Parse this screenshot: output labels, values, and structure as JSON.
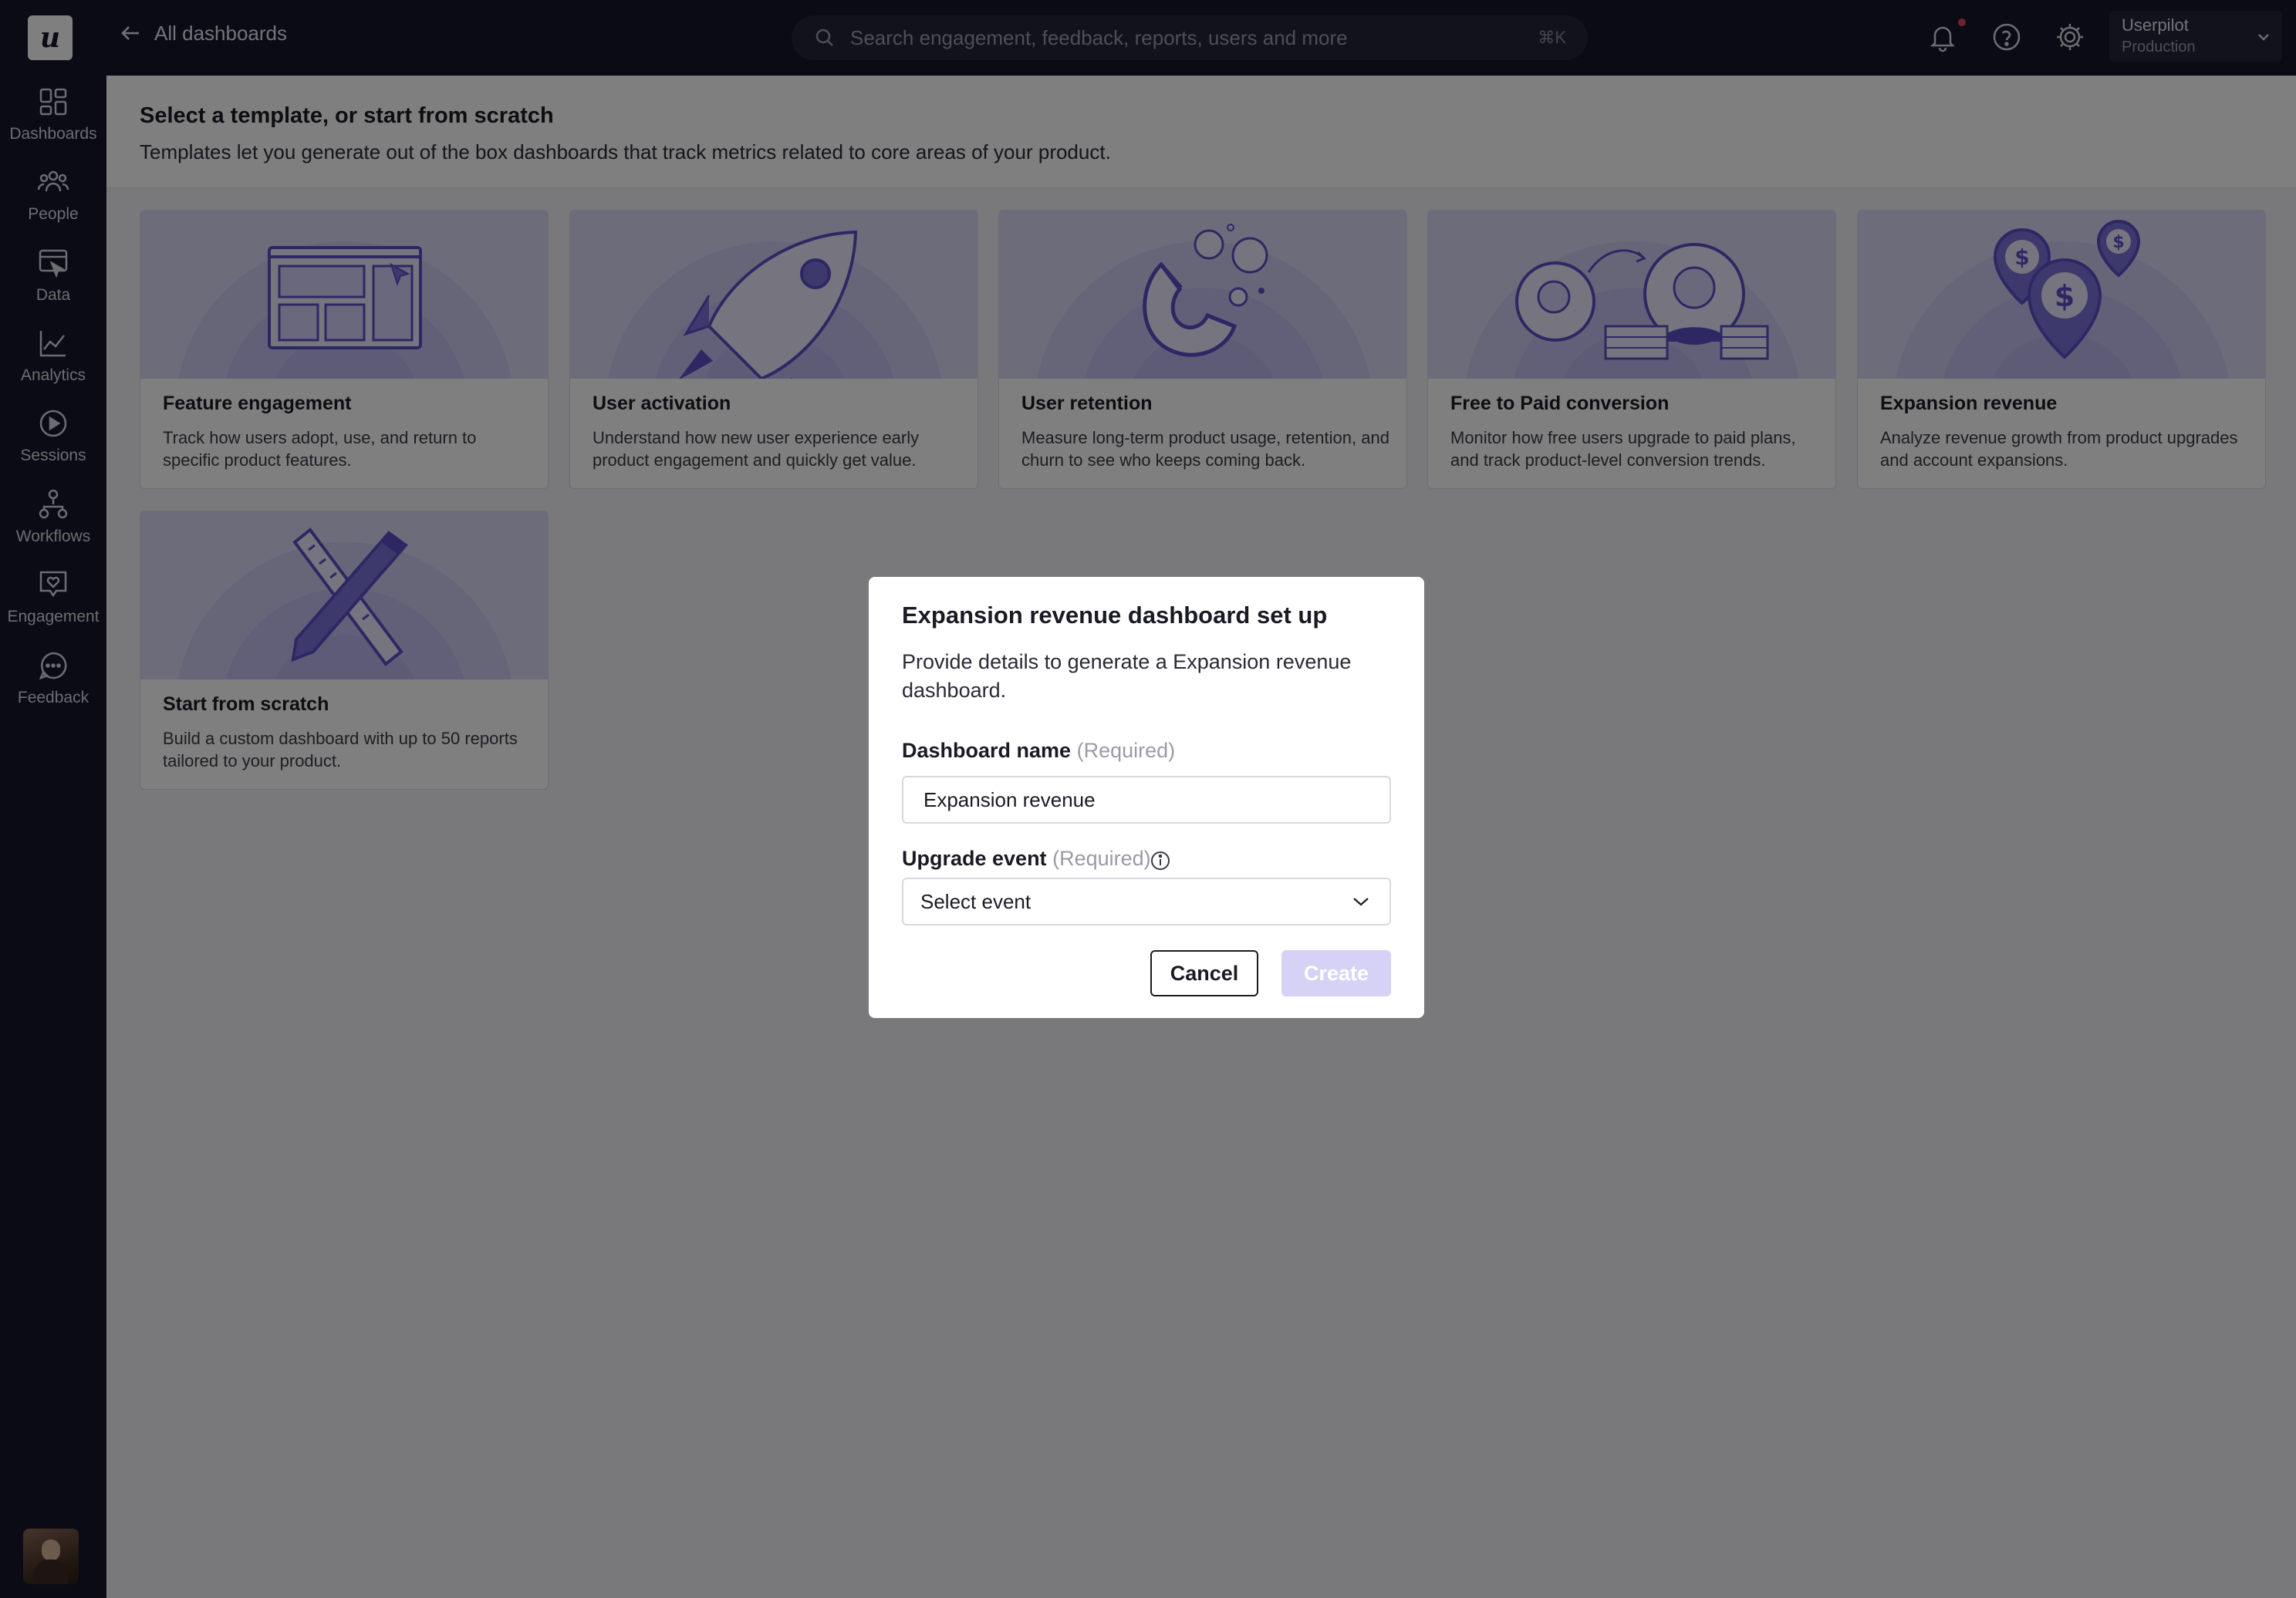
{
  "app": {
    "logo_letter": "u"
  },
  "sidebar": {
    "items": [
      {
        "label": "Dashboards",
        "icon": "dashboards-icon"
      },
      {
        "label": "People",
        "icon": "people-icon"
      },
      {
        "label": "Data",
        "icon": "data-icon"
      },
      {
        "label": "Analytics",
        "icon": "analytics-icon"
      },
      {
        "label": "Sessions",
        "icon": "sessions-icon"
      },
      {
        "label": "Workflows",
        "icon": "workflows-icon"
      },
      {
        "label": "Engagement",
        "icon": "engagement-icon"
      },
      {
        "label": "Feedback",
        "icon": "feedback-icon"
      }
    ]
  },
  "topbar": {
    "back_label": "All dashboards",
    "search_placeholder": "Search engagement, feedback, reports, users and more",
    "search_shortcut": "⌘K",
    "account_name": "Userpilot",
    "account_env": "Production"
  },
  "page": {
    "title": "Select a template, or start from scratch",
    "subtitle": "Templates let you generate out of the box dashboards that track metrics related to core areas of your product."
  },
  "templates": [
    {
      "title": "Feature engagement",
      "desc": "Track how users adopt, use, and return to specific product features."
    },
    {
      "title": "User activation",
      "desc": "Understand how new user experience early product engagement and quickly get value."
    },
    {
      "title": "User retention",
      "desc": "Measure long-term product usage, retention, and churn to see who keeps coming back."
    },
    {
      "title": "Free to Paid conversion",
      "desc": "Monitor how free users upgrade to paid plans, and track product-level conversion trends."
    },
    {
      "title": "Expansion revenue",
      "desc": "Analyze revenue growth from product upgrades and account expansions."
    },
    {
      "title": "Start from scratch",
      "desc": "Build a custom dashboard with up to 50 reports tailored to your product."
    }
  ],
  "modal": {
    "title": "Expansion revenue dashboard set up",
    "description": "Provide details to generate a Expansion revenue dashboard.",
    "name_label": "Dashboard name",
    "name_required": "(Required)",
    "name_value": "Expansion revenue",
    "event_label": "Upgrade event",
    "event_required": "(Required)",
    "event_value": "Select event",
    "cancel_label": "Cancel",
    "create_label": "Create"
  },
  "colors": {
    "nav_bg": "#17172b",
    "accent": "#5b51c7",
    "card_art_bg": "#d9d8f7",
    "create_disabled": "#d6d2f6",
    "notification_dot": "#e0455a"
  }
}
